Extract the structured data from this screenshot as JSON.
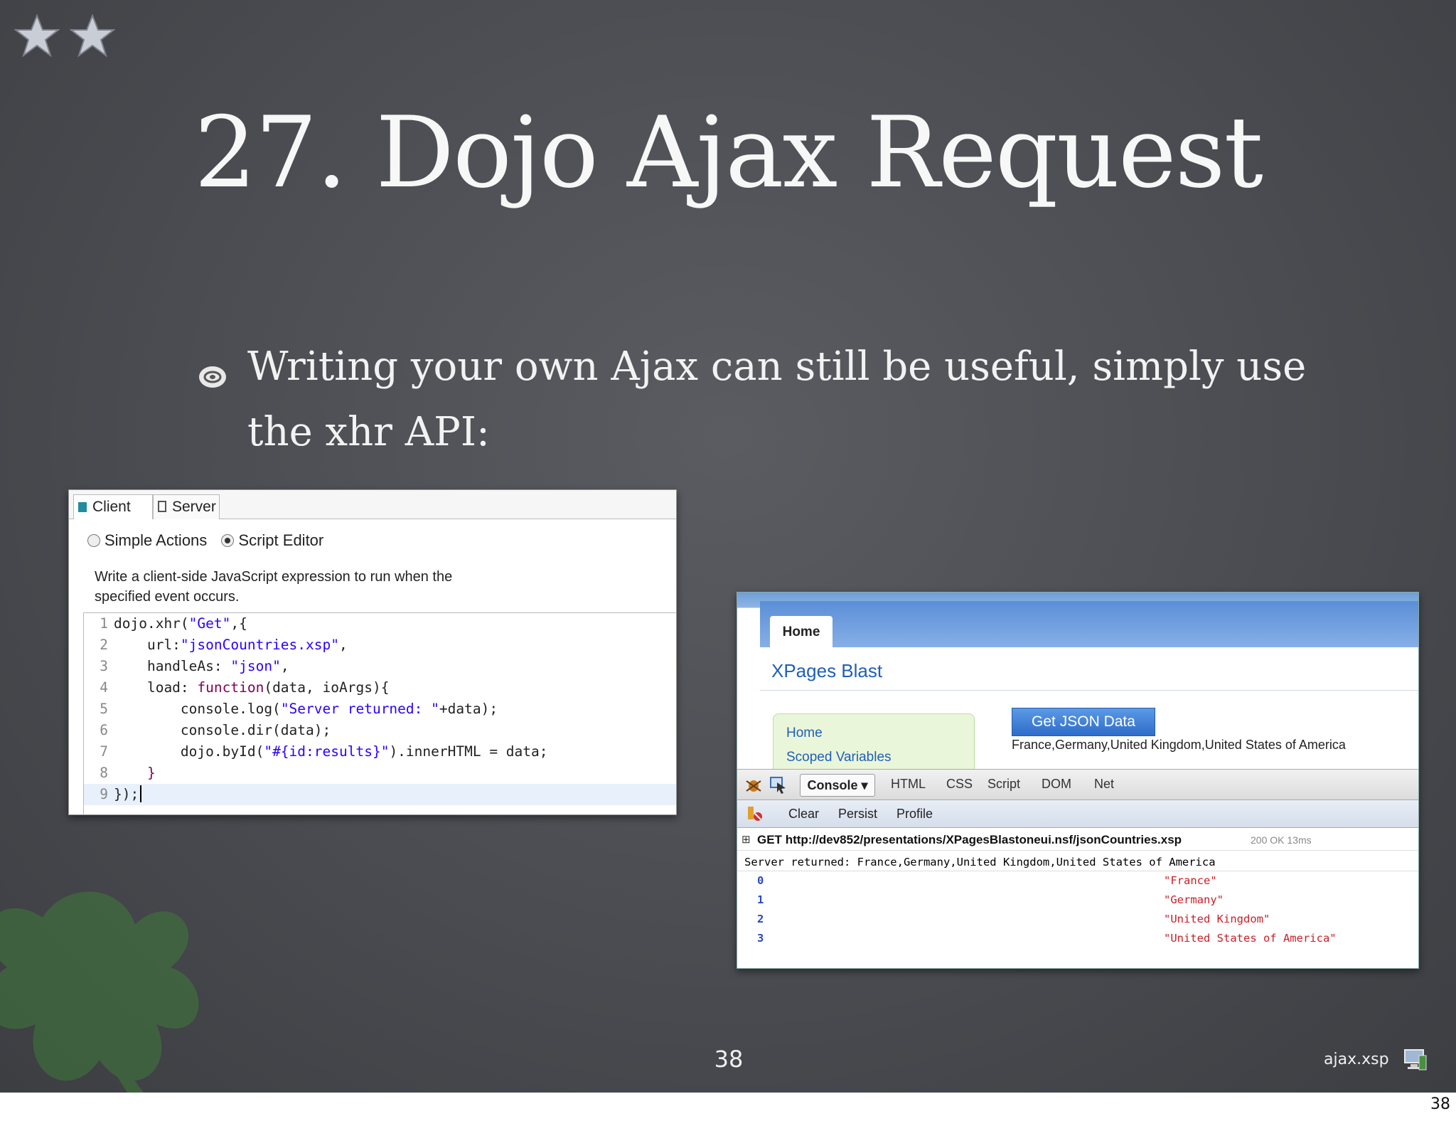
{
  "slide": {
    "title": "27. Dojo Ajax Request",
    "bullet": "Writing your own Ajax can still be useful, simply use the xhr API:",
    "slide_number": "38",
    "footer_file": "ajax.xsp",
    "page_number": "38",
    "icons": [
      "star-icon",
      "star-icon",
      "bullet-icon",
      "clover-icon",
      "computer-icon"
    ],
    "colors": {
      "background": "#4a4c51",
      "text": "#f2f2f2"
    }
  },
  "editor": {
    "tabs": [
      "Client",
      "Server"
    ],
    "radios": [
      {
        "label": "Simple Actions",
        "selected": false
      },
      {
        "label": "Script Editor",
        "selected": true
      }
    ],
    "description": "Write a client-side JavaScript expression to run when the specified event occurs.",
    "code_lines": [
      {
        "n": "1",
        "text": "dojo.xhr(\"Get\",{"
      },
      {
        "n": "2",
        "text": "    url:\"jsonCountries.xsp\","
      },
      {
        "n": "3",
        "text": "    handleAs: \"json\","
      },
      {
        "n": "4",
        "text": "    load: function(data, ioArgs){"
      },
      {
        "n": "5",
        "text": "        console.log(\"Server returned: \"+data);"
      },
      {
        "n": "6",
        "text": "        console.dir(data);"
      },
      {
        "n": "7",
        "text": "        dojo.byId(\"#{id:results}\").innerHTML = data;"
      },
      {
        "n": "8",
        "text": "    }"
      },
      {
        "n": "9",
        "text": "});"
      }
    ]
  },
  "browser": {
    "home_tab": "Home",
    "app_title": "XPages Blast",
    "nav": [
      "Home",
      "Scoped Variables"
    ],
    "button": "Get JSON Data",
    "result": "France,Germany,United Kingdom,United States of America",
    "firebug_tabs": [
      "Console",
      "HTML",
      "CSS",
      "Script",
      "DOM",
      "Net"
    ],
    "console_buttons": [
      "Clear",
      "Persist",
      "Profile"
    ],
    "request": {
      "method": "GET",
      "url": "http://dev852/presentations/XPagesBlastoneui.nsf/jsonCountries.xsp",
      "status": "200 OK",
      "time": "13ms"
    },
    "log": "Server returned: France,Germany,United Kingdom,United States of America",
    "dir": [
      {
        "index": "0",
        "value": "\"France\""
      },
      {
        "index": "1",
        "value": "\"Germany\""
      },
      {
        "index": "2",
        "value": "\"United Kingdom\""
      },
      {
        "index": "3",
        "value": "\"United States of America\""
      }
    ]
  }
}
